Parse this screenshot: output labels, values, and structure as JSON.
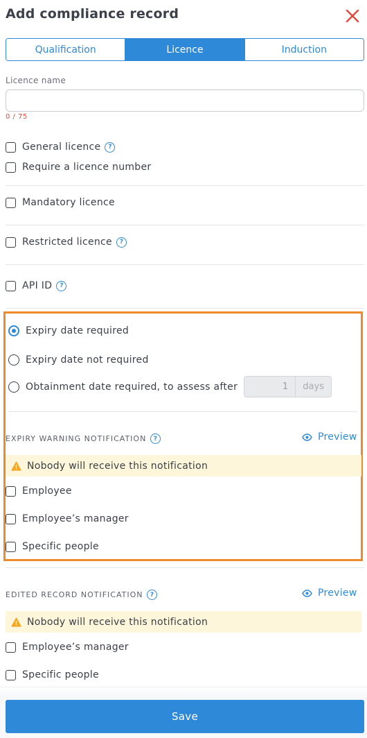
{
  "header": {
    "title": "Add compliance record"
  },
  "tabs": [
    {
      "label": "Qualification",
      "active": false
    },
    {
      "label": "Licence",
      "active": true
    },
    {
      "label": "Induction",
      "active": false
    }
  ],
  "licence_name": {
    "label": "Licence name",
    "value": "",
    "placeholder": "",
    "counter": "0 / 75"
  },
  "options": {
    "general": "General licence",
    "require_number": "Require a licence number",
    "mandatory": "Mandatory licence",
    "restricted": "Restricted licence",
    "api_id": "API ID"
  },
  "expiry": {
    "required": "Expiry date required",
    "not_required": "Expiry date not required",
    "obtainment": "Obtainment date required, to assess after",
    "days_value": "1",
    "days_unit": "days",
    "selected": "required"
  },
  "expiry_warning": {
    "heading": "EXPIRY WARNING NOTIFICATION",
    "preview": "Preview",
    "warning": "Nobody will receive this notification",
    "recipients": [
      "Employee",
      "Employee’s manager",
      "Specific people"
    ]
  },
  "edited_record": {
    "heading": "EDITED RECORD NOTIFICATION",
    "preview": "Preview",
    "warning": "Nobody will receive this notification",
    "recipients": [
      "Employee’s manager",
      "Specific people"
    ]
  },
  "footer": {
    "save": "Save"
  },
  "colors": {
    "accent": "#2e8ad8",
    "highlight": "#ef8a2b",
    "warning_bg": "#fdf6da",
    "close": "#e4483c"
  }
}
